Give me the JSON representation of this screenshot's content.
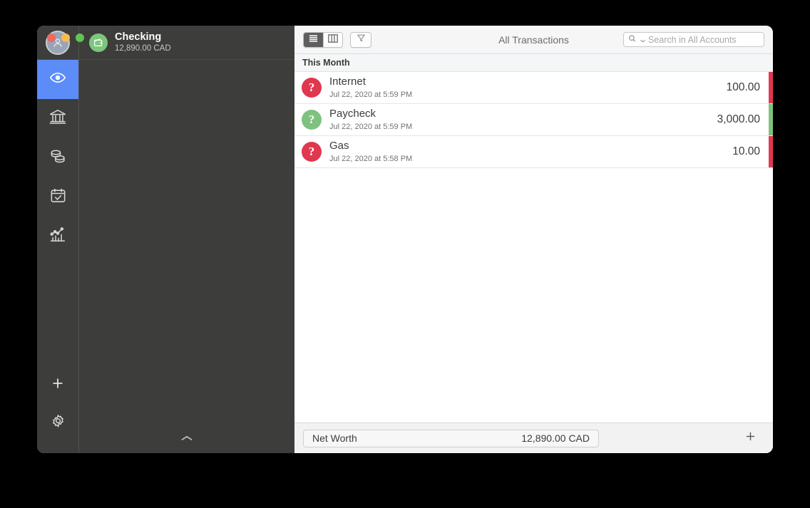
{
  "window": {
    "traffic_lights": [
      "close",
      "minimize",
      "zoom"
    ]
  },
  "rail": {
    "avatar_icon": "person-avatar-icon",
    "items": [
      {
        "id": "overview",
        "icon": "eye-icon",
        "label": "Overview",
        "active": true
      },
      {
        "id": "accounts",
        "icon": "bank-icon",
        "label": "Accounts",
        "active": false
      },
      {
        "id": "budget",
        "icon": "coins-icon",
        "label": "Budget",
        "active": false
      },
      {
        "id": "scheduled",
        "icon": "calendar-check-icon",
        "label": "Scheduled",
        "active": false
      },
      {
        "id": "reports",
        "icon": "chart-icon",
        "label": "Reports",
        "active": false
      }
    ],
    "bottom_items": [
      {
        "id": "add",
        "icon": "plus-icon",
        "label": "Add"
      },
      {
        "id": "settings",
        "icon": "gear-icon",
        "label": "Settings"
      }
    ]
  },
  "accounts_panel": {
    "account": {
      "icon": "wallet-icon",
      "icon_color": "#7dc67d",
      "name": "Checking",
      "balance": "12,890.00 CAD"
    },
    "collapse_icon": "chevron-up-icon"
  },
  "toolbar": {
    "view_modes": [
      {
        "id": "list",
        "icon": "list-view-icon",
        "selected": true
      },
      {
        "id": "column",
        "icon": "column-view-icon",
        "selected": false
      }
    ],
    "filter_icon": "filter-funnel-icon",
    "title": "All Transactions",
    "search": {
      "icon": "search-icon",
      "chevron_icon": "chevron-down-icon",
      "placeholder": "Search in All Accounts",
      "value": ""
    }
  },
  "transactions": {
    "group_label": "This Month",
    "rows": [
      {
        "category_icon": "question-mark-icon",
        "category_color": "#e0384f",
        "edge_color": "#e0384f",
        "title": "Internet",
        "date": "Jul 22, 2020 at 5:59 PM",
        "amount": "100.00"
      },
      {
        "category_icon": "question-mark-icon",
        "category_color": "#7fc17f",
        "edge_color": "#7fc17f",
        "title": "Paycheck",
        "date": "Jul 22, 2020 at 5:59 PM",
        "amount": "3,000.00"
      },
      {
        "category_icon": "question-mark-icon",
        "category_color": "#e0384f",
        "edge_color": "#e0384f",
        "title": "Gas",
        "date": "Jul 22, 2020 at 5:58 PM",
        "amount": "10.00"
      }
    ]
  },
  "footer": {
    "net_worth_label": "Net Worth",
    "net_worth_value": "12,890.00 CAD",
    "add_icon": "plus-icon"
  },
  "colors": {
    "accent_blue": "#5b8cf8",
    "dark_panel": "#3d3d3b",
    "positive_green": "#7fc17f",
    "negative_red": "#e0384f"
  }
}
